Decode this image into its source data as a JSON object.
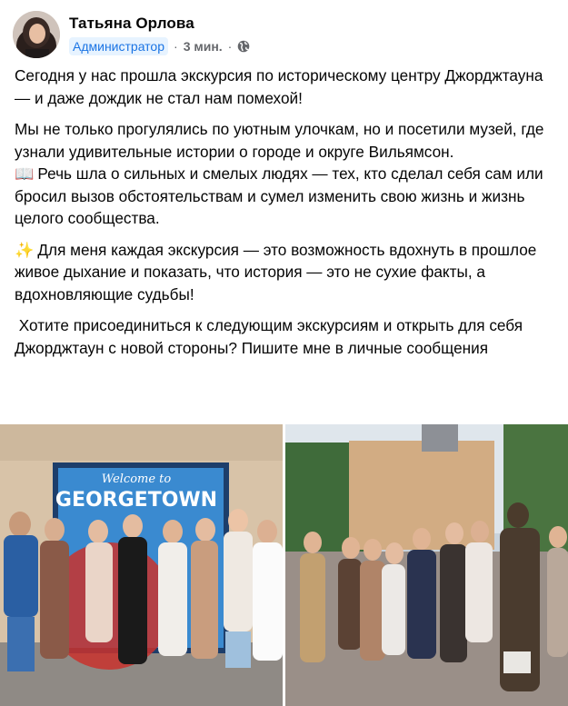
{
  "author": {
    "name": "Татьяна Орлова",
    "role": "Администратор",
    "time": "3 мин.",
    "separator": "·"
  },
  "post": {
    "p1": "Сегодня у нас прошла экскурсия по историческому центру Джорджтауна — и даже дождик не стал нам помехой!",
    "p2a": "Мы не только прогулялись по уютным улочкам, но и посетили музей, где узнали удивительные истории о городе и округе Вильямсон.",
    "p2b": "Речь шла о сильных и смелых людях — тех, кто сделал себя сам или бросил вызов обстоятельствам и сумел изменить свою жизнь и жизнь целого сообщества.",
    "p3": "Для меня каждая экскурсия — это возможность вдохнуть в прошлое живое дыхание и показать, что история — это не сухие факты, а вдохновляющие судьбы!",
    "p4": "Хотите присоединиться к следующим экскурсиям и открыть для себя Джорджтаун с новой стороны? Пишите мне в личные сообщения",
    "emoji_book": "📖",
    "emoji_sparkles": "✨"
  },
  "photos": {
    "left_sign_line1": "Welcome to",
    "left_sign_line2": "GEORGETOWN"
  },
  "icons": {
    "avatar": "avatar",
    "globe": "globe-icon"
  },
  "colors": {
    "badge_bg": "#e7f3ff",
    "badge_text": "#1b74e4",
    "meta_gray": "#65676b",
    "text": "#050505"
  }
}
